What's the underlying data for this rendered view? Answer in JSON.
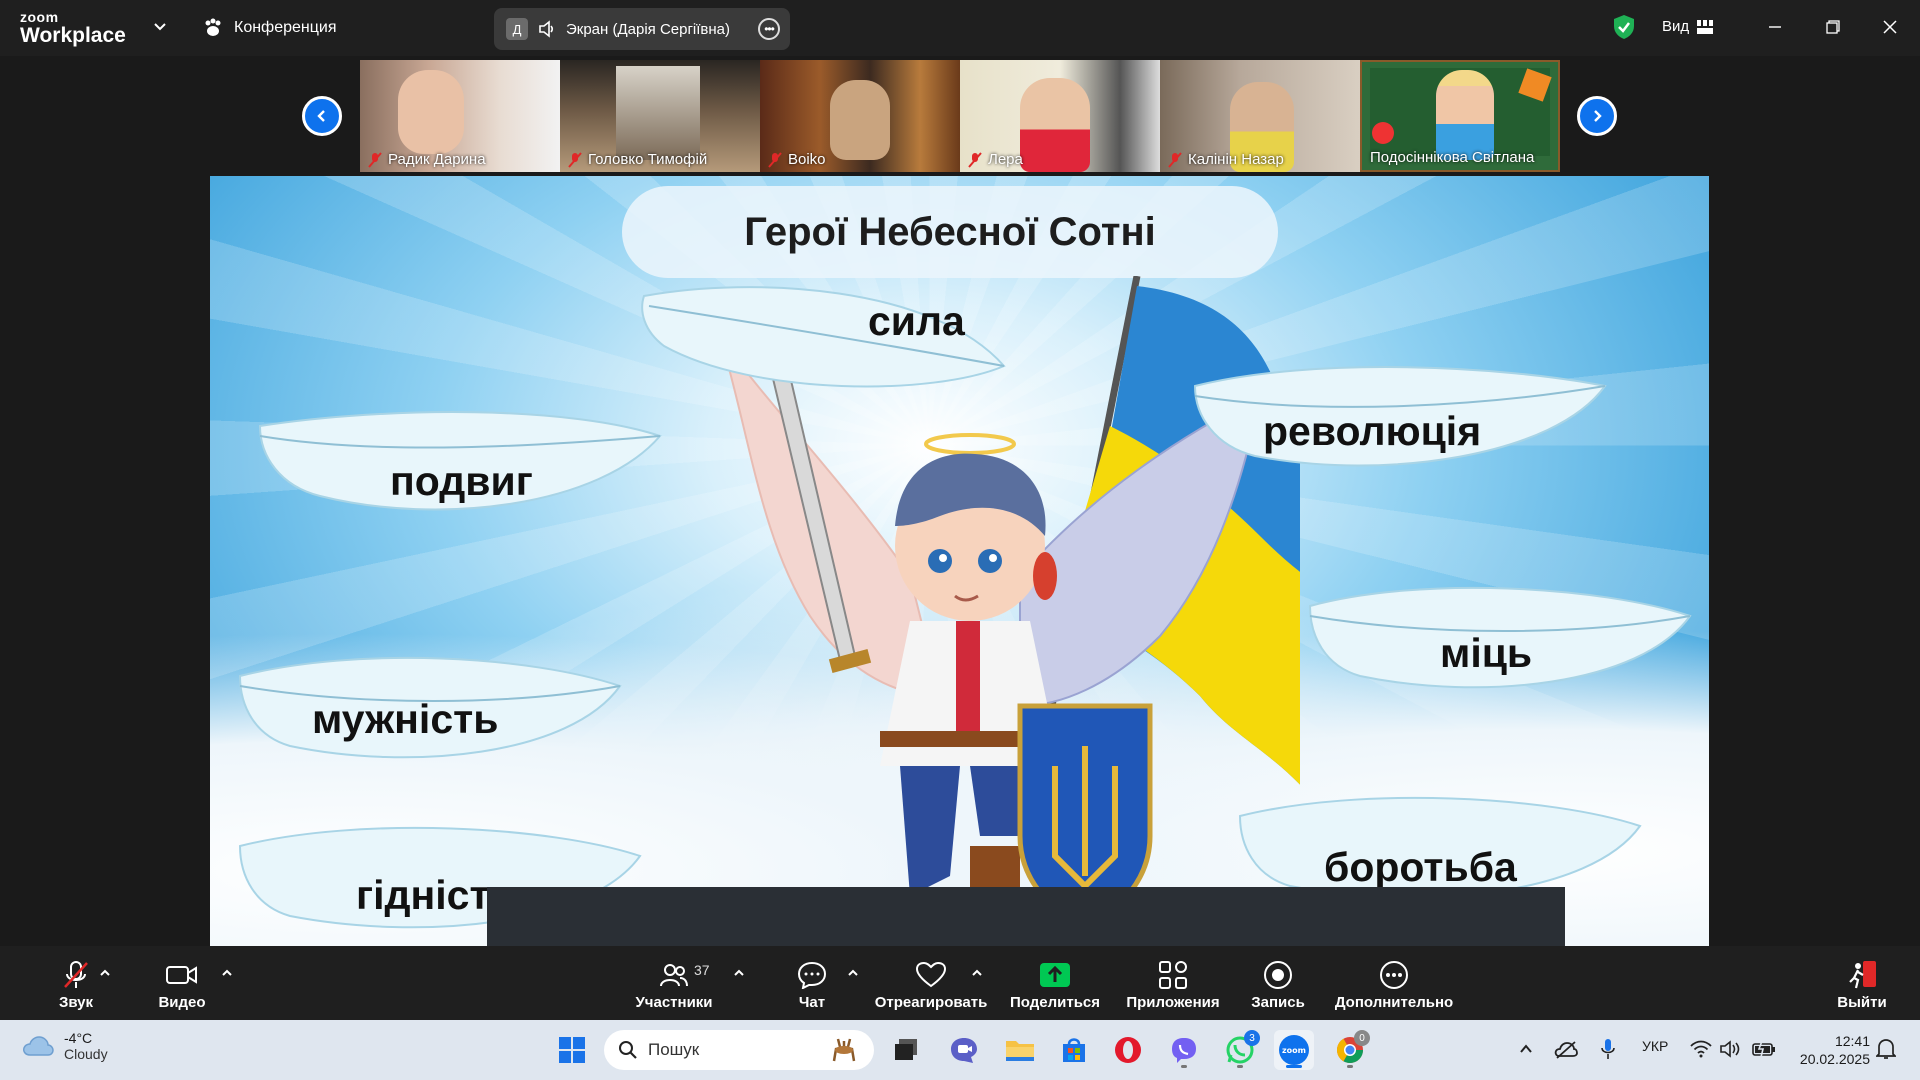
{
  "app": {
    "logo_top": "zoom",
    "logo_bottom": "Workplace",
    "meeting_label": "Конференция",
    "share_avatar": "Д",
    "share_label": "Экран (Дарія Сергіївна)",
    "view_label": "Вид"
  },
  "participants": [
    {
      "name": "Радик Дарина"
    },
    {
      "name": "Головко Тимофій"
    },
    {
      "name": "Boiko"
    },
    {
      "name": "Лера"
    },
    {
      "name": "Калінін Назар"
    },
    {
      "name": "Подосіннікова Світлана"
    }
  ],
  "slide": {
    "title": "Герої Небесної Сотні",
    "words": {
      "sila": "сила",
      "podvyh": "подвиг",
      "revoliutsiia": "революція",
      "mits": "міць",
      "muzhnist": "мужність",
      "hidnist": "гідніст",
      "borotba": "боротьба"
    }
  },
  "toolbar": {
    "audio": "Звук",
    "video": "Видео",
    "participants": "Участники",
    "participants_count": "37",
    "chat": "Чат",
    "react": "Отреагировать",
    "share": "Поделиться",
    "apps": "Приложения",
    "record": "Запись",
    "more": "Дополнительно",
    "leave": "Выйти"
  },
  "taskbar": {
    "temp": "-4°C",
    "weather": "Cloudy",
    "search_placeholder": "Пошук",
    "lang": "УКР",
    "time": "12:41",
    "date": "20.02.2025",
    "whatsapp_badge": "3",
    "chrome_badge": "0"
  },
  "colors": {
    "zoom_blue": "#0e72ed",
    "share_green": "#00c853",
    "toolbar_bg": "#1f1f1f",
    "taskbar_bg": "#dfe6ef"
  }
}
